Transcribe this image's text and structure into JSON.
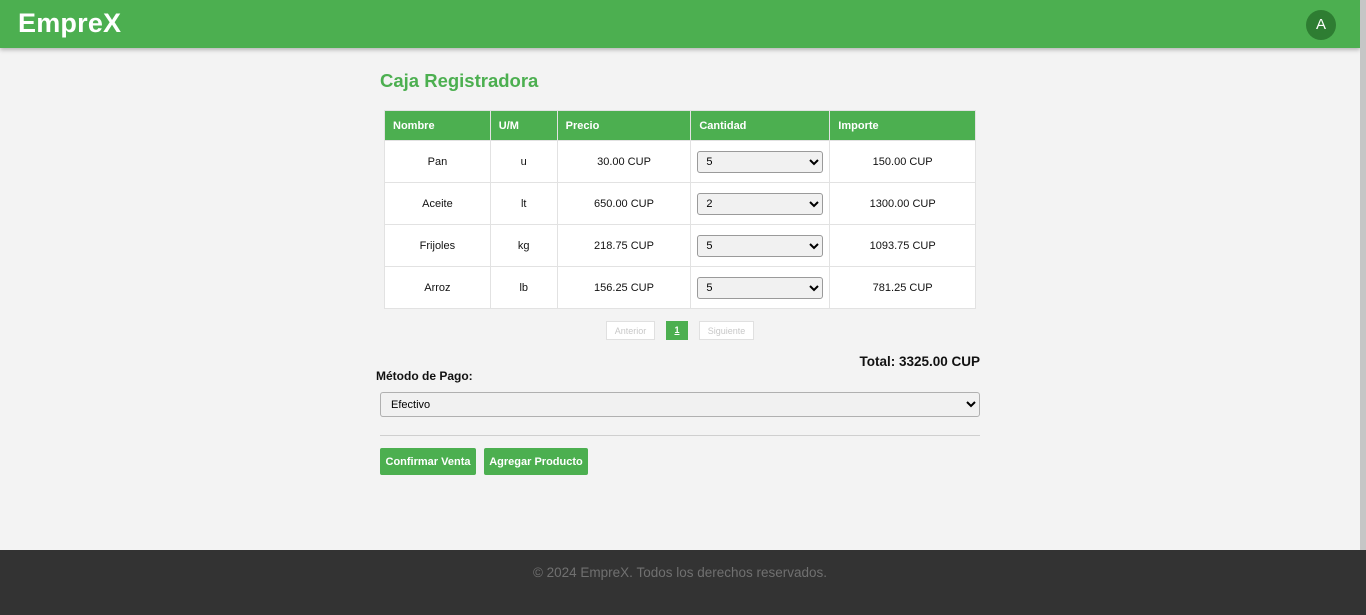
{
  "app": {
    "brand": "EmpreX",
    "user_initial": "A"
  },
  "page": {
    "title": "Caja Registradora"
  },
  "table": {
    "headers": [
      "Nombre",
      "U/M",
      "Precio",
      "Cantidad",
      "Importe"
    ],
    "rows": [
      {
        "nombre": "Pan",
        "um": "u",
        "precio": "30.00 CUP",
        "cantidad": "5",
        "importe": "150.00 CUP"
      },
      {
        "nombre": "Aceite",
        "um": "lt",
        "precio": "650.00 CUP",
        "cantidad": "2",
        "importe": "1300.00 CUP"
      },
      {
        "nombre": "Frijoles",
        "um": "kg",
        "precio": "218.75 CUP",
        "cantidad": "5",
        "importe": "1093.75 CUP"
      },
      {
        "nombre": "Arroz",
        "um": "lb",
        "precio": "156.25 CUP",
        "cantidad": "5",
        "importe": "781.25 CUP"
      }
    ]
  },
  "pagination": {
    "prev_label": "Anterior",
    "current_page": "1",
    "next_label": "Siguiente"
  },
  "total": {
    "text": "Total: 3325.00 CUP"
  },
  "payment": {
    "label": "Método de Pago:",
    "selected": "Efectivo"
  },
  "actions": {
    "confirm_label": "Confirmar Venta",
    "add_label": "Agregar Producto"
  },
  "footer": {
    "text": "© 2024 EmpreX. Todos los derechos reservados."
  },
  "colors": {
    "primary": "#4caf50",
    "avatar_bg": "#2e7d32",
    "footer_bg": "#333333"
  }
}
